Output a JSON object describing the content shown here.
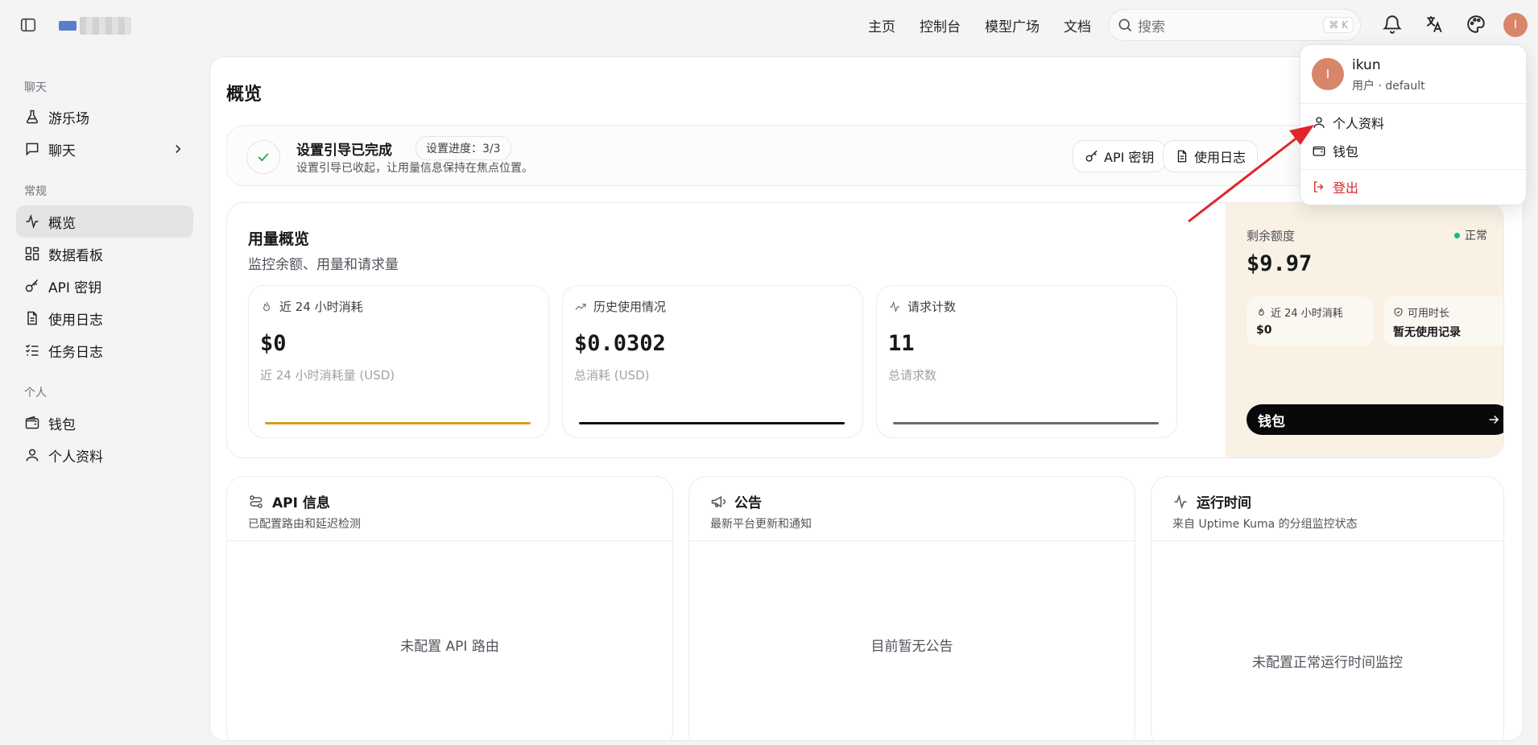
{
  "topbar": {
    "nav": [
      "主页",
      "控制台",
      "模型广场",
      "文档"
    ],
    "search_placeholder": "搜索",
    "search_shortcut": "⌘ K",
    "avatar_letter": "I"
  },
  "sidebar": {
    "sections": [
      {
        "title": "聊天",
        "items": [
          {
            "label": "游乐场",
            "icon": "flask-icon"
          },
          {
            "label": "聊天",
            "icon": "message-icon"
          }
        ]
      },
      {
        "title": "常规",
        "items": [
          {
            "label": "概览",
            "icon": "activity-icon"
          },
          {
            "label": "数据看板",
            "icon": "dashboard-icon"
          },
          {
            "label": "API 密钥",
            "icon": "key-icon"
          },
          {
            "label": "使用日志",
            "icon": "file-text-icon"
          },
          {
            "label": "任务日志",
            "icon": "list-checks-icon"
          }
        ]
      },
      {
        "title": "个人",
        "items": [
          {
            "label": "钱包",
            "icon": "wallet-icon"
          },
          {
            "label": "个人资料",
            "icon": "user-icon"
          }
        ]
      }
    ],
    "active": "概览"
  },
  "main": {
    "title": "概览",
    "setup": {
      "title": "设置引导已完成",
      "progress": "设置进度：3/3",
      "desc": "设置引导已收起，让用量信息保持在焦点位置。",
      "buttons": [
        "API 密钥",
        "使用日志"
      ]
    },
    "usage": {
      "title": "用量概览",
      "subtitle": "监控余额、用量和请求量",
      "stats": [
        {
          "label": "近 24 小时消耗",
          "value": "$0",
          "sub": "近 24 小时消耗量 (USD)",
          "color": "#d4a017"
        },
        {
          "label": "历史使用情况",
          "value": "$0.0302",
          "sub": "总消耗 (USD)",
          "color": "#111111"
        },
        {
          "label": "请求计数",
          "value": "11",
          "sub": "总请求数",
          "color": "#6b6b6b"
        }
      ]
    },
    "balance": {
      "label": "剩余额度",
      "status": "正常",
      "amount": "$9.97",
      "mini": [
        {
          "label": "近 24 小时消耗",
          "value": "$0"
        },
        {
          "label": "可用时长",
          "value": "暂无使用记录"
        }
      ],
      "wallet_button": "钱包"
    },
    "cards": [
      {
        "title": "API 信息",
        "desc": "已配置路由和延迟检测",
        "empty": "未配置 API 路由"
      },
      {
        "title": "公告",
        "desc": "最新平台更新和通知",
        "empty": "目前暂无公告"
      },
      {
        "title": "运行时间",
        "desc": "来自 Uptime Kuma 的分组监控状态",
        "empty": "未配置正常运行时间监控"
      }
    ]
  },
  "user_menu": {
    "avatar_letter": "I",
    "name": "ikun",
    "role": "用户 · default",
    "items": [
      "个人资料",
      "钱包"
    ],
    "logout": "登出"
  }
}
